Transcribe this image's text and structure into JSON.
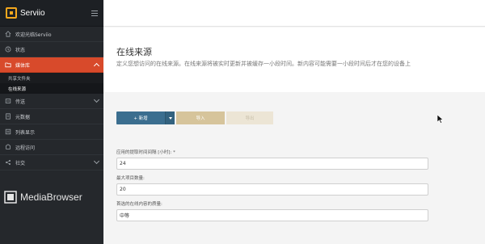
{
  "app": {
    "name": "Serviio",
    "brand_color": "#f4a81d"
  },
  "sidebar": {
    "items": [
      {
        "label": "欢迎光临Serviio",
        "icon": "home-icon"
      },
      {
        "label": "状态",
        "icon": "status-icon"
      },
      {
        "label": "媒体库",
        "icon": "folder-icon",
        "active": true,
        "expanded": true
      },
      {
        "label": "传送",
        "icon": "transfer-icon"
      },
      {
        "label": "元数据",
        "icon": "metadata-icon"
      },
      {
        "label": "列表显示",
        "icon": "list-icon"
      },
      {
        "label": "远程访问",
        "icon": "remote-icon"
      },
      {
        "label": "社交",
        "icon": "share-icon"
      }
    ],
    "sub_items": [
      {
        "label": "共享文件夹"
      },
      {
        "label": "在线来源",
        "selected": true
      }
    ],
    "footer_logo": "MediaBrowser"
  },
  "page": {
    "title": "在线来源",
    "description": "定义您想访问的在线来源。在线来源将被实时更新并被缓存一小段时间。新内容可能需要一小段时间后才在您的设备上"
  },
  "toolbar": {
    "new_label": "+ 新增",
    "import_label": "导入",
    "export_label": "导出"
  },
  "form": {
    "refresh_label": "应用的提取时间间隔 [小时]: *",
    "refresh_value": "24",
    "max_items_label": "最大项目数量:",
    "max_items_value": "20",
    "quality_label": "首选的在线内容的质量:",
    "quality_value": "中等"
  },
  "colors": {
    "sidebar_bg": "#25282c",
    "active_item": "#d84a2b",
    "primary_button": "#3b6e8f",
    "import_button": "#d6c49b"
  }
}
